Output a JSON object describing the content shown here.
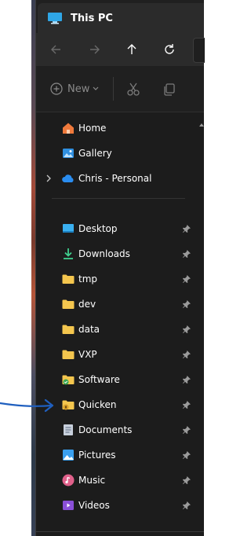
{
  "window": {
    "title": "This PC"
  },
  "toolbar": {
    "new_label": "New"
  },
  "nav_top": [
    {
      "label": "Home",
      "icon": "home-icon"
    },
    {
      "label": "Gallery",
      "icon": "gallery-icon"
    },
    {
      "label": "Chris - Personal",
      "icon": "onedrive-cloud-icon",
      "expandable": true
    }
  ],
  "quick_access": [
    {
      "label": "Desktop",
      "icon": "desktop-icon",
      "pinned": true
    },
    {
      "label": "Downloads",
      "icon": "downloads-icon",
      "pinned": true
    },
    {
      "label": "tmp",
      "icon": "folder-icon",
      "pinned": true
    },
    {
      "label": "dev",
      "icon": "folder-icon",
      "pinned": true
    },
    {
      "label": "data",
      "icon": "folder-icon",
      "pinned": true
    },
    {
      "label": "VXP",
      "icon": "folder-icon",
      "pinned": true
    },
    {
      "label": "Software",
      "icon": "folder-synced-icon",
      "pinned": true
    },
    {
      "label": "Quicken",
      "icon": "folder-locked-icon",
      "pinned": true
    },
    {
      "label": "Documents",
      "icon": "documents-icon",
      "pinned": true
    },
    {
      "label": "Pictures",
      "icon": "pictures-icon",
      "pinned": true
    },
    {
      "label": "Music",
      "icon": "music-icon",
      "pinned": true
    },
    {
      "label": "Videos",
      "icon": "videos-icon",
      "pinned": true
    }
  ],
  "colors": {
    "window_bg": "#1c1c1c",
    "toolbar_bg": "#202020",
    "folder": "#f4c64e",
    "annotation_arrow": "#1f5fbf"
  }
}
